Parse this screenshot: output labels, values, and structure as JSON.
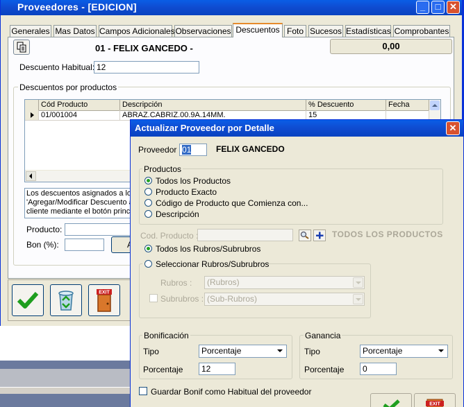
{
  "main_window": {
    "title": "Proveedores - [EDICION]",
    "controls": {
      "minimize": "_",
      "maximize": "□",
      "close": "✕"
    },
    "tabs": [
      {
        "label": "Generales"
      },
      {
        "label": "Mas Datos"
      },
      {
        "label": "Campos Adicionales"
      },
      {
        "label": "Observaciones"
      },
      {
        "label": "Descuentos",
        "active": true
      },
      {
        "label": "Foto"
      },
      {
        "label": "Sucesos"
      },
      {
        "label": "Estadísticas"
      },
      {
        "label": "Comprobantes"
      }
    ],
    "provider_header": "01 - FELIX GANCEDO -",
    "total_value": "0,00",
    "descuento_habitual": {
      "label": "Descuento Habitual:",
      "value": "12"
    },
    "descuentos_productos": {
      "group_label": "Descuentos por productos",
      "columns": [
        "Cód Producto",
        "Descripción",
        "% Descuento",
        "Fecha"
      ],
      "rows": [
        {
          "codigo": "01/001004",
          "descripcion": "ABRAZ.CABRIZ.00.9A.14MM.",
          "descuento": "15",
          "fecha": ""
        }
      ],
      "info_lines": [
        "Los descuentos asignados a los",
        "'Agregar/Modificar Descuento a",
        "cliente mediante el botón princip"
      ],
      "producto_label": "Producto:",
      "bon_label": "Bon (%):",
      "add_button_fragment": "A"
    },
    "toolbar": {
      "accept": "check-icon",
      "recycle": "recycle-icon",
      "exit": "exit-icon",
      "exit_text": "EXIT"
    }
  },
  "dialog": {
    "title": "Actualizar Proveedor por Detalle",
    "close": "✕",
    "proveedor_label": "Proveedor :",
    "proveedor_code": "01",
    "proveedor_name": "FELIX GANCEDO",
    "productos": {
      "group_label": "Productos",
      "options": [
        {
          "label": "Todos los Productos",
          "selected": true
        },
        {
          "label": "Producto Exacto",
          "selected": false
        },
        {
          "label": "Código de Producto que Comienza con...",
          "selected": false
        },
        {
          "label": "Descripción",
          "selected": false
        }
      ]
    },
    "cod_producto_label": "Cod. Producto :",
    "cod_producto_value": "",
    "todos_productos_caption": "TODOS LOS PRODUCTOS",
    "rubros_all": {
      "label": "Todos los Rubros/Subrubros",
      "selected": true
    },
    "rubros_select": {
      "label": "Seleccionar Rubros/Subrubros",
      "selected": false,
      "rubros_label": "Rubros :",
      "rubros_value": "(Rubros)",
      "subrubros_label": "Subrubros :",
      "subrubros_value": "(Sub-Rubros)"
    },
    "bonificacion": {
      "group_label": "Bonificación",
      "tipo_label": "Tipo",
      "tipo_value": "Porcentaje",
      "porcentaje_label": "Porcentaje",
      "porcentaje_value": "12"
    },
    "ganancia": {
      "group_label": "Ganancia",
      "tipo_label": "Tipo",
      "tipo_value": "Porcentaje",
      "porcentaje_label": "Porcentaje",
      "porcentaje_value": "0"
    },
    "guardar_label": "Guardar Bonif como Habitual del proveedor",
    "exit_text": "EXIT"
  }
}
